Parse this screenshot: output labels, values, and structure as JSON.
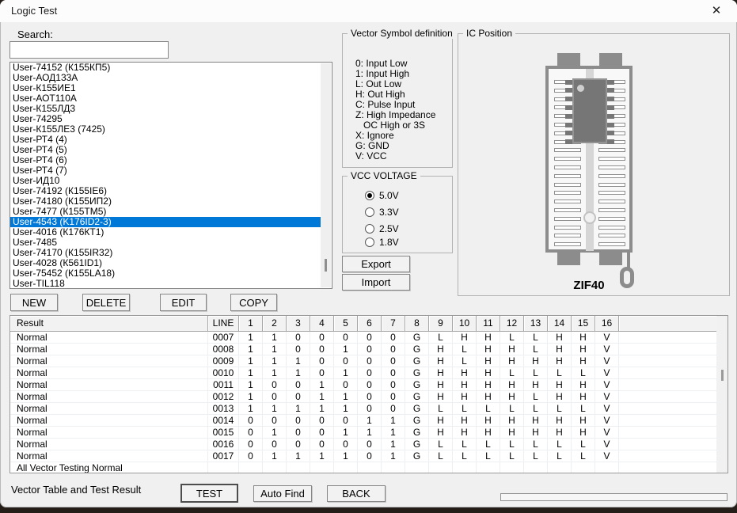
{
  "window": {
    "title": "Logic Test",
    "close_icon": "✕"
  },
  "colors": {
    "accent": "#0078d7",
    "selection_text": "#ffffff",
    "socket_gray": "#8c8c8c"
  },
  "search": {
    "label": "Search:",
    "value": "",
    "placeholder": ""
  },
  "chip_list": {
    "selected_index": 15,
    "items": [
      "User-74152 (К155КП5)",
      "User-АОД133А",
      "User-К155ИЕ1",
      "User-АОТ110А",
      "User-К155ЛД3",
      "User-74295",
      "User-К155ЛЕ3 (7425)",
      "User-РТ4 (4)",
      "User-РТ4 (5)",
      "User-РТ4 (6)",
      "User-РТ4 (7)",
      "User-ИД10",
      "User-74192 (К155IE6)",
      "User-74180 (К155ИП2)",
      "User-7477 (К155ТМ5)",
      "User-4543 (K176ID2-3)",
      "User-4016 (К176КТ1)",
      "User-7485",
      "User-74170 (К155IR32)",
      "User-4028 (К561ID1)",
      "User-75452 (К155LA18)",
      "User-TIL118"
    ]
  },
  "action_buttons": {
    "new": "NEW",
    "delete": "DELETE",
    "edit": "EDIT",
    "copy": "COPY"
  },
  "vector_symbols": {
    "title": "Vector Symbol definition",
    "lines": [
      "0: Input Low",
      "1: Input High",
      "L: Out Low",
      "H: Out High",
      "C: Pulse Input",
      "Z: High Impedance",
      "   OC High or 3S",
      "X: Ignore",
      "G: GND",
      "V: VCC"
    ]
  },
  "vcc": {
    "title": "VCC VOLTAGE",
    "options": [
      "5.0V",
      "3.3V",
      "2.5V",
      "1.8V"
    ],
    "selected": "5.0V"
  },
  "io_buttons": {
    "export": "Export",
    "import": "Import"
  },
  "ic_position": {
    "title": "IC Position",
    "socket_label": "ZIF40",
    "pins_per_side": 20,
    "chip_rows": 8
  },
  "table": {
    "headers": [
      "Result",
      "LINE",
      "1",
      "2",
      "3",
      "4",
      "5",
      "6",
      "7",
      "8",
      "9",
      "10",
      "11",
      "12",
      "13",
      "14",
      "15",
      "16"
    ],
    "rows": [
      {
        "result": "Normal",
        "line": "0007",
        "pins": [
          "1",
          "1",
          "0",
          "0",
          "0",
          "0",
          "0",
          "G",
          "L",
          "H",
          "H",
          "L",
          "L",
          "H",
          "H",
          "V"
        ]
      },
      {
        "result": "Normal",
        "line": "0008",
        "pins": [
          "1",
          "1",
          "0",
          "0",
          "1",
          "0",
          "0",
          "G",
          "H",
          "L",
          "H",
          "H",
          "L",
          "H",
          "H",
          "V"
        ]
      },
      {
        "result": "Normal",
        "line": "0009",
        "pins": [
          "1",
          "1",
          "1",
          "0",
          "0",
          "0",
          "0",
          "G",
          "H",
          "L",
          "H",
          "H",
          "H",
          "H",
          "H",
          "V"
        ]
      },
      {
        "result": "Normal",
        "line": "0010",
        "pins": [
          "1",
          "1",
          "1",
          "0",
          "1",
          "0",
          "0",
          "G",
          "H",
          "H",
          "H",
          "L",
          "L",
          "L",
          "L",
          "V"
        ]
      },
      {
        "result": "Normal",
        "line": "0011",
        "pins": [
          "1",
          "0",
          "0",
          "1",
          "0",
          "0",
          "0",
          "G",
          "H",
          "H",
          "H",
          "H",
          "H",
          "H",
          "H",
          "V"
        ]
      },
      {
        "result": "Normal",
        "line": "0012",
        "pins": [
          "1",
          "0",
          "0",
          "1",
          "1",
          "0",
          "0",
          "G",
          "H",
          "H",
          "H",
          "H",
          "L",
          "H",
          "H",
          "V"
        ]
      },
      {
        "result": "Normal",
        "line": "0013",
        "pins": [
          "1",
          "1",
          "1",
          "1",
          "1",
          "0",
          "0",
          "G",
          "L",
          "L",
          "L",
          "L",
          "L",
          "L",
          "L",
          "V"
        ]
      },
      {
        "result": "Normal",
        "line": "0014",
        "pins": [
          "0",
          "0",
          "0",
          "0",
          "0",
          "1",
          "1",
          "G",
          "H",
          "H",
          "H",
          "H",
          "H",
          "H",
          "H",
          "V"
        ]
      },
      {
        "result": "Normal",
        "line": "0015",
        "pins": [
          "0",
          "1",
          "0",
          "0",
          "1",
          "1",
          "1",
          "G",
          "H",
          "H",
          "H",
          "H",
          "H",
          "H",
          "H",
          "V"
        ]
      },
      {
        "result": "Normal",
        "line": "0016",
        "pins": [
          "0",
          "0",
          "0",
          "0",
          "0",
          "0",
          "1",
          "G",
          "L",
          "L",
          "L",
          "L",
          "L",
          "L",
          "L",
          "V"
        ]
      },
      {
        "result": "Normal",
        "line": "0017",
        "pins": [
          "0",
          "1",
          "1",
          "1",
          "1",
          "0",
          "1",
          "G",
          "L",
          "L",
          "L",
          "L",
          "L",
          "L",
          "L",
          "V"
        ]
      }
    ],
    "footer": "All Vector Testing Normal"
  },
  "bottom": {
    "status": "Vector Table and Test Result",
    "test": "TEST",
    "auto_find": "Auto Find",
    "back": "BACK"
  }
}
